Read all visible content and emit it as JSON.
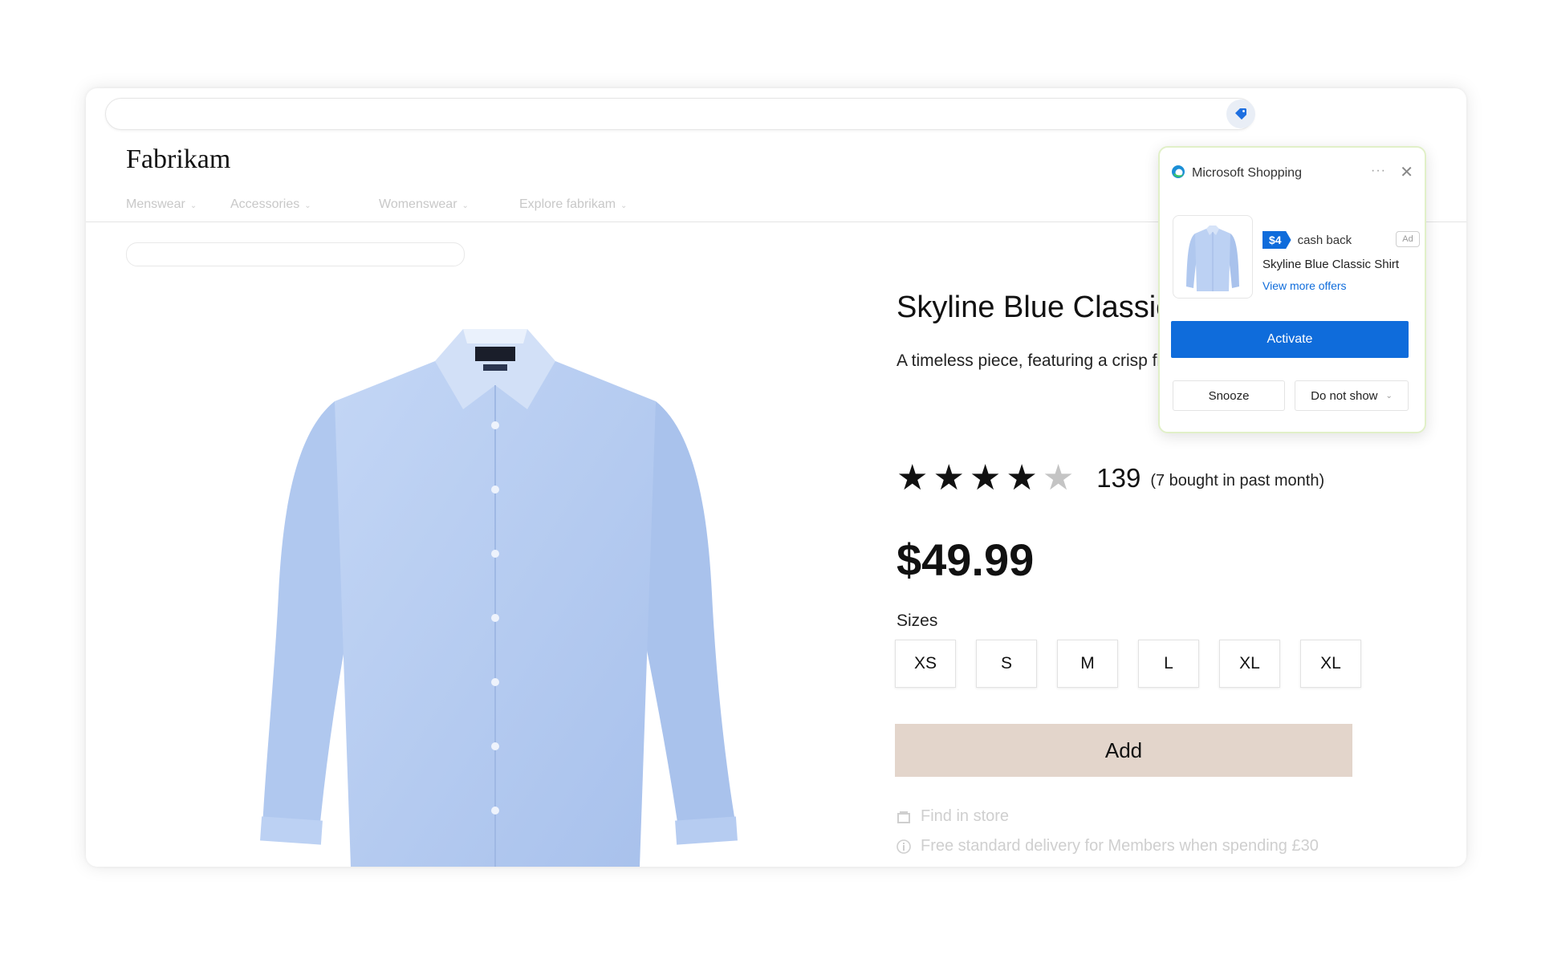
{
  "colors": {
    "accent": "#0f6cdb",
    "add_button_bg": "#e3d5cb",
    "popup_border": "#e1f0c8",
    "shirt_blue": "#b3cbf0"
  },
  "browser": {
    "address_bar_icon": "shopping-tag-icon"
  },
  "site": {
    "brand": "Fabrikam",
    "nav": [
      {
        "label": "Menswear"
      },
      {
        "label": "Accessories"
      },
      {
        "label": "Womenswear"
      },
      {
        "label": "Explore fabrikam"
      }
    ]
  },
  "product": {
    "title": "Skyline Blue Classic",
    "description": "A timeless piece, featuring a crisp fit that exudes both elegance and",
    "rating_stars": 4,
    "rating_max": 5,
    "review_count": "139",
    "review_note": "(7 bought in past month)",
    "price": "$49.99",
    "sizes_label": "Sizes",
    "sizes": [
      "XS",
      "S",
      "M",
      "L",
      "XL",
      "XL"
    ],
    "add_label": "Add",
    "find_in_store": "Find in store",
    "delivery_note": "Free standard delivery for Members when spending £30"
  },
  "shopping_popup": {
    "title": "Microsoft Shopping",
    "more": "···",
    "close": "✕",
    "cashback_amount": "$4",
    "cashback_label": "cash back",
    "ad_badge": "Ad",
    "product_name": "Skyline Blue Classic Shirt",
    "more_offers": "View more offers",
    "activate": "Activate",
    "snooze": "Snooze",
    "do_not_show": "Do not show"
  }
}
